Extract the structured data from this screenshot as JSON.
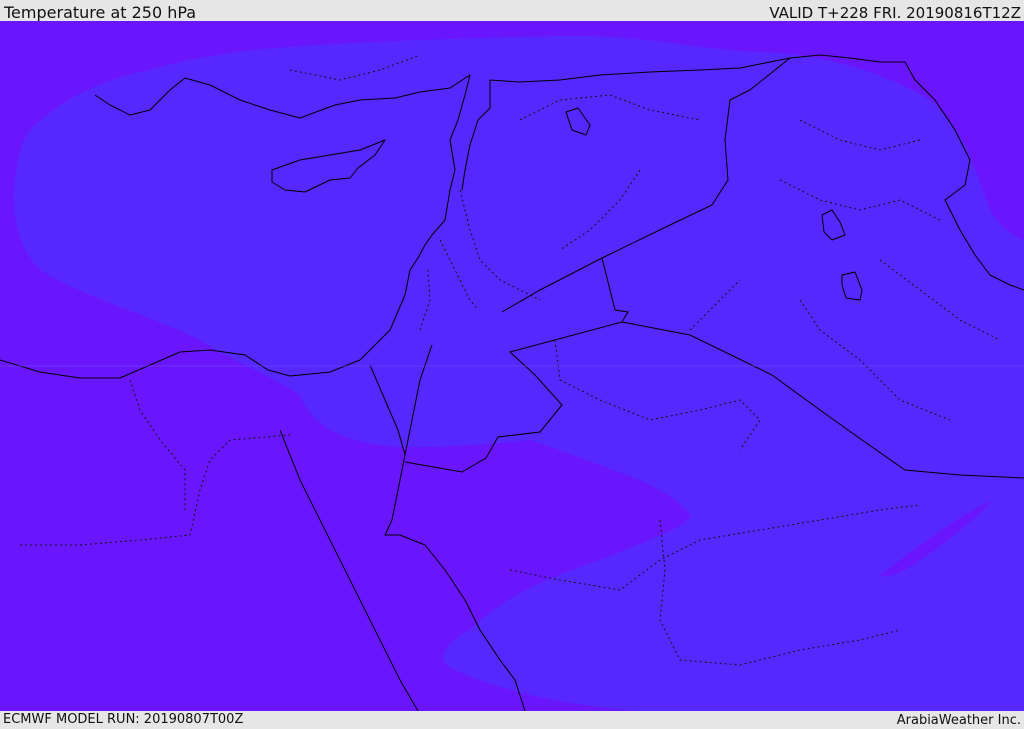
{
  "header": {
    "title": "Temperature at 250 hPa",
    "valid": "VALID T+228 FRI. 20190816T12Z"
  },
  "footer": {
    "model_run": "ECMWF MODEL RUN: 20190807T00Z",
    "brand": "ArabiaWeather Inc."
  },
  "map": {
    "field": "temperature",
    "level": "250 hPa",
    "colors": {
      "cold_band": "#6a16fd",
      "warm_band": "#5628fd",
      "coastline": "#000000"
    }
  }
}
